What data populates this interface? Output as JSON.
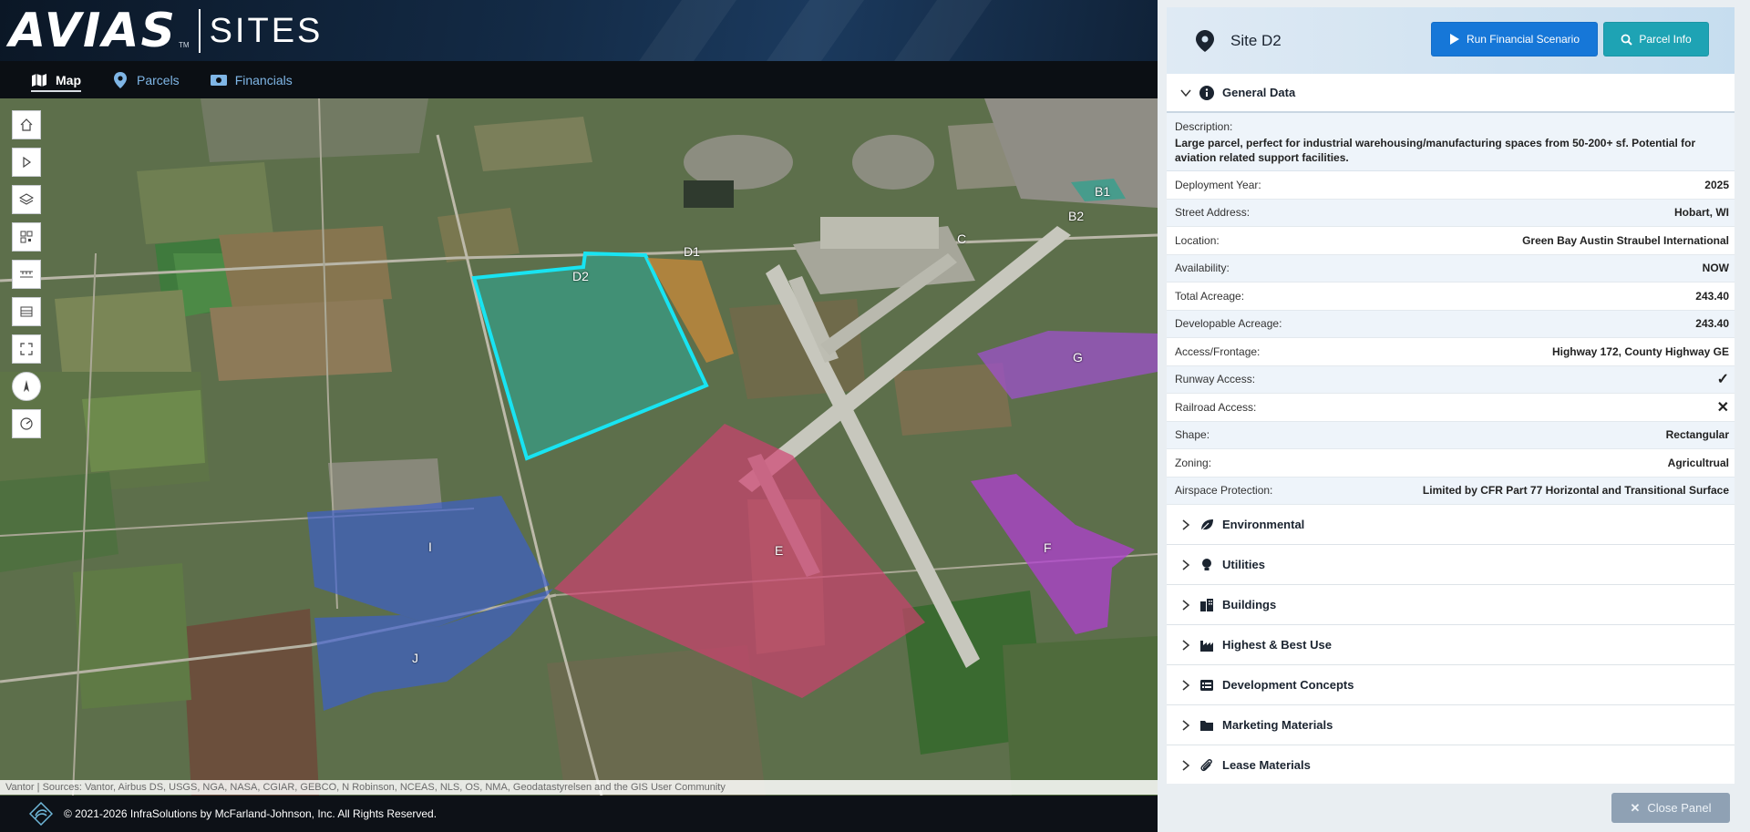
{
  "app": {
    "logo_main": "AVIAS",
    "logo_sub": "SITES"
  },
  "nav": {
    "tabs": [
      {
        "label": "Map",
        "icon": "map-icon",
        "active": true
      },
      {
        "label": "Parcels",
        "icon": "pin-icon",
        "active": false
      },
      {
        "label": "Financials",
        "icon": "money-icon",
        "active": false
      }
    ]
  },
  "map": {
    "toolbar": [
      "home-icon",
      "play-icon",
      "layers-icon",
      "qr-icon",
      "measure-icon",
      "basemap-icon",
      "fullscreen-icon",
      "compass-icon",
      "gauge-icon"
    ],
    "parcels": [
      {
        "label": "D2",
        "color": "#1fb7a8",
        "selected": true
      },
      {
        "label": "D1",
        "color": "#c98a3a"
      },
      {
        "label": "B1",
        "color": "#2fa18f"
      },
      {
        "label": "B2",
        "color": ""
      },
      {
        "label": "C",
        "color": ""
      },
      {
        "label": "G",
        "color": "#a04fd0"
      },
      {
        "label": "F",
        "color": "#b03fd0"
      },
      {
        "label": "E",
        "color": "#d04070"
      },
      {
        "label": "I",
        "color": "#3b5ed0"
      },
      {
        "label": "J",
        "color": "#3b5ed0"
      }
    ],
    "attribution": "Vantor | Sources: Vantor, Airbus DS, USGS, NGA, NASA, CGIAR, GEBCO, N Robinson, NCEAS, NLS, OS, NMA, Geodatastyrelsen and the GIS User Community"
  },
  "footer": {
    "copyright": "© 2021-2026 InfraSolutions by McFarland-Johnson, Inc. All Rights Reserved."
  },
  "panel": {
    "title": "Site D2",
    "run_button": "Run Financial Scenario",
    "parcel_button": "Parcel Info",
    "general": {
      "title": "General Data",
      "description_label": "Description:",
      "description": "Large parcel, perfect for industrial warehousing/manufacturing spaces from 50-200+ sf. Potential for aviation related support facilities.",
      "rows": [
        {
          "k": "Deployment Year:",
          "v": "2025"
        },
        {
          "k": "Street Address:",
          "v": "Hobart, WI"
        },
        {
          "k": "Location:",
          "v": "Green Bay Austin Straubel International"
        },
        {
          "k": "Availability:",
          "v": "NOW"
        },
        {
          "k": "Total Acreage:",
          "v": "243.40"
        },
        {
          "k": "Developable Acreage:",
          "v": "243.40"
        },
        {
          "k": "Access/Frontage:",
          "v": "Highway 172, County Highway GE"
        },
        {
          "k": "Runway Access:",
          "v": "✓"
        },
        {
          "k": "Railroad Access:",
          "v": "✕"
        },
        {
          "k": "Shape:",
          "v": "Rectangular"
        },
        {
          "k": "Zoning:",
          "v": "Agricultrual"
        },
        {
          "k": "Airspace Protection:",
          "v": "Limited by CFR Part 77 Horizontal and Transitional Surface"
        }
      ]
    },
    "sections": [
      {
        "label": "Environmental",
        "icon": "leaf-icon"
      },
      {
        "label": "Utilities",
        "icon": "lightbulb-icon"
      },
      {
        "label": "Buildings",
        "icon": "building-icon"
      },
      {
        "label": "Highest & Best Use",
        "icon": "industry-icon"
      },
      {
        "label": "Development Concepts",
        "icon": "list-icon"
      },
      {
        "label": "Marketing Materials",
        "icon": "folder-icon"
      },
      {
        "label": "Lease Materials",
        "icon": "paperclip-icon"
      }
    ],
    "close_button": "Close Panel"
  }
}
